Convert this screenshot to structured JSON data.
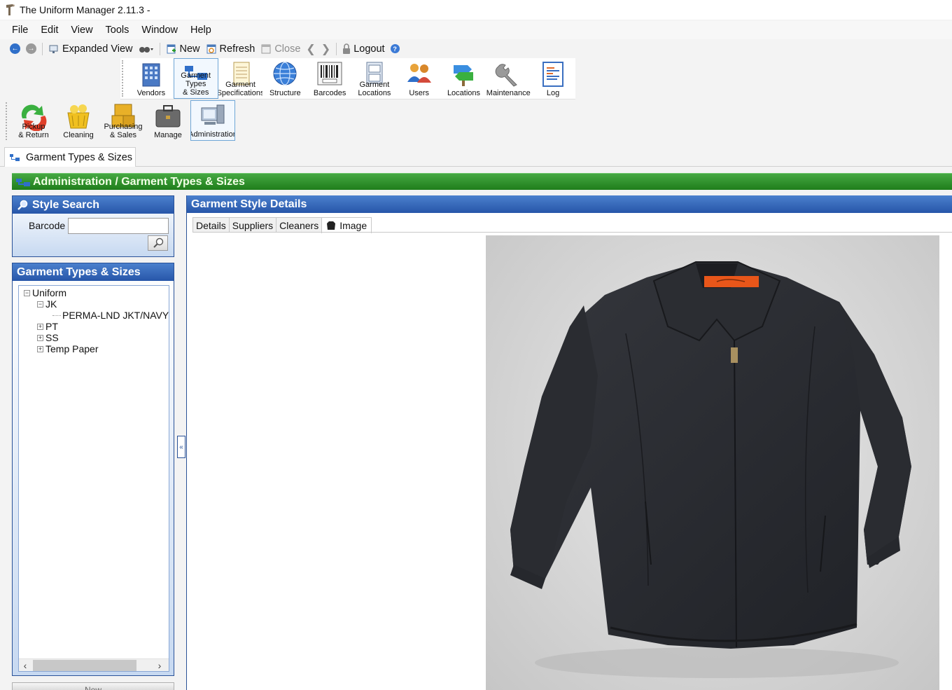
{
  "window": {
    "title": "The Uniform Manager 2.11.3 -"
  },
  "menu": [
    "File",
    "Edit",
    "View",
    "Tools",
    "Window",
    "Help"
  ],
  "toolbar": {
    "expanded_view": "Expanded View",
    "new": "New",
    "refresh": "Refresh",
    "close": "Close",
    "logout": "Logout"
  },
  "ribbon_admin": [
    {
      "line1": "",
      "line2": "Vendors"
    },
    {
      "line1": "Garment",
      "line2": "Types",
      "line3": "& Sizes"
    },
    {
      "line1": "Garment",
      "line2": "Specifications"
    },
    {
      "line1": "",
      "line2": "Structure"
    },
    {
      "line1": "",
      "line2": "Barcodes"
    },
    {
      "line1": "Garment",
      "line2": "Locations"
    },
    {
      "line1": "",
      "line2": "Users"
    },
    {
      "line1": "",
      "line2": "Locations"
    },
    {
      "line1": "",
      "line2": "Maintenance"
    },
    {
      "line1": "",
      "line2": "Log"
    }
  ],
  "ribbon_main": [
    {
      "line1": "Pickup",
      "line2": "& Return"
    },
    {
      "line1": "",
      "line2": "Cleaning"
    },
    {
      "line1": "Purchasing",
      "line2": "& Sales"
    },
    {
      "line1": "",
      "line2": "Manage"
    },
    {
      "line1": "",
      "line2": "Administration"
    }
  ],
  "doc_tab": "Garment Types & Sizes",
  "breadcrumb": "Administration / Garment Types & Sizes",
  "style_search": {
    "title": "Style Search",
    "barcode_label": "Barcode",
    "barcode_value": ""
  },
  "gts_panel": {
    "title": "Garment Types & Sizes",
    "tree": {
      "root": "Uniform",
      "jk": "JK",
      "jk_child": "PERMA-LND JKT/NAVY T",
      "pt": "PT",
      "ss": "SS",
      "temp": "Temp Paper"
    },
    "new_button": "New"
  },
  "details_panel": {
    "title": "Garment Style Details",
    "tabs": [
      "Details",
      "Suppliers",
      "Cleaners",
      "Image"
    ],
    "active_tab": "Image"
  },
  "colors": {
    "header_blue": "#2756a9",
    "header_green": "#1f7d1b",
    "selection_border": "#6fa6d6"
  }
}
